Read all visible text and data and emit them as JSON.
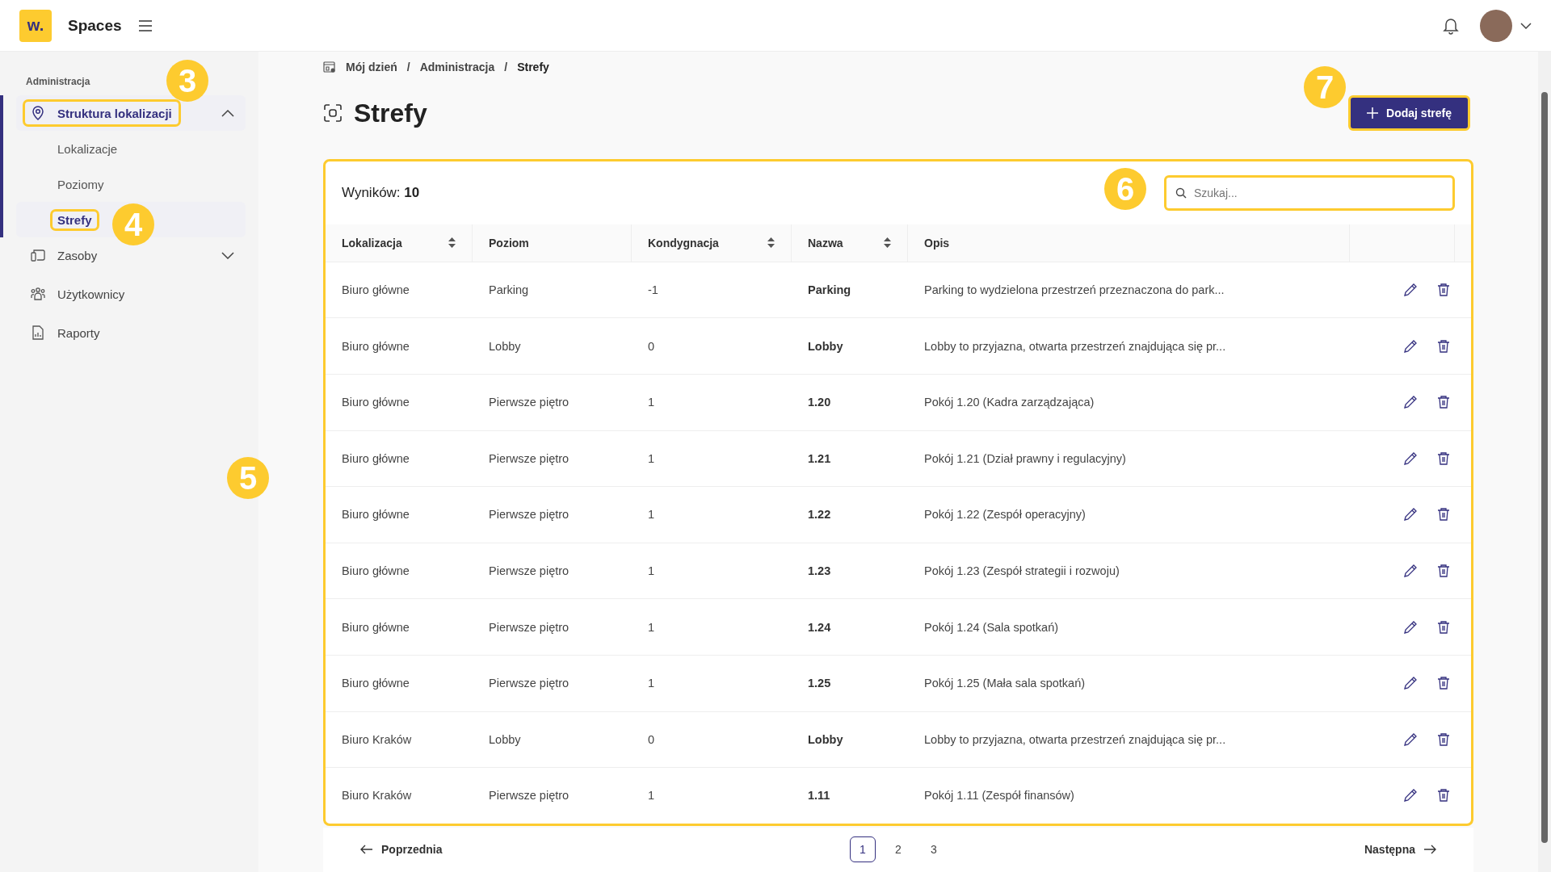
{
  "app": {
    "logo": "w.",
    "title": "Spaces"
  },
  "sidebar": {
    "section": "Administracja",
    "items": [
      {
        "label": "Struktura lokalizacji",
        "kind": "location",
        "expanded": true,
        "selected": true,
        "highlighted": true,
        "children": [
          {
            "label": "Lokalizacje",
            "selected": false,
            "highlighted": false
          },
          {
            "label": "Poziomy",
            "selected": false,
            "highlighted": false
          },
          {
            "label": "Strefy",
            "selected": true,
            "highlighted": true
          }
        ]
      },
      {
        "label": "Zasoby",
        "kind": "devices",
        "expanded": false,
        "selected": false,
        "highlighted": false
      },
      {
        "label": "Użytkownicy",
        "kind": "users",
        "selected": false,
        "highlighted": false
      },
      {
        "label": "Raporty",
        "kind": "reports",
        "selected": false,
        "highlighted": false
      }
    ]
  },
  "breadcrumb": [
    {
      "kind": "link",
      "text": "Mój dzień"
    },
    {
      "kind": "separator",
      "text": "/"
    },
    {
      "kind": "link",
      "text": "Administracja"
    },
    {
      "kind": "separator",
      "text": "/"
    },
    {
      "kind": "current",
      "text": "Strefy"
    }
  ],
  "page_title": "Strefy",
  "add_button": {
    "label": "Dodaj strefę",
    "highlighted": true
  },
  "results": {
    "label": "Wyników:",
    "count": "10"
  },
  "search": {
    "placeholder": "Szukaj...",
    "highlighted": true
  },
  "table": {
    "highlighted": true,
    "columns": [
      {
        "label": "Lokalizacja",
        "sortable": true
      },
      {
        "label": "Poziom",
        "sortable": false
      },
      {
        "label": "Kondygnacja",
        "sortable": true
      },
      {
        "label": "Nazwa",
        "sortable": true
      },
      {
        "label": "Opis",
        "sortable": false
      }
    ],
    "rows": [
      [
        "Biuro główne",
        "Parking",
        "-1",
        "Parking",
        "Parking to wydzielona przestrzeń przeznaczona do park..."
      ],
      [
        "Biuro główne",
        "Lobby",
        "0",
        "Lobby",
        "Lobby to przyjazna, otwarta przestrzeń znajdująca się pr..."
      ],
      [
        "Biuro główne",
        "Pierwsze piętro",
        "1",
        "1.20",
        "Pokój 1.20 (Kadra zarządzająca)"
      ],
      [
        "Biuro główne",
        "Pierwsze piętro",
        "1",
        "1.21",
        "Pokój 1.21 (Dział prawny i regulacyjny)"
      ],
      [
        "Biuro główne",
        "Pierwsze piętro",
        "1",
        "1.22",
        "Pokój 1.22 (Zespół operacyjny)"
      ],
      [
        "Biuro główne",
        "Pierwsze piętro",
        "1",
        "1.23",
        "Pokój 1.23 (Zespół strategii i rozwoju)"
      ],
      [
        "Biuro główne",
        "Pierwsze piętro",
        "1",
        "1.24",
        "Pokój 1.24 (Sala spotkań)"
      ],
      [
        "Biuro główne",
        "Pierwsze piętro",
        "1",
        "1.25",
        "Pokój 1.25 (Mała sala spotkań)"
      ],
      [
        "Biuro Kraków",
        "Lobby",
        "0",
        "Lobby",
        "Lobby to przyjazna, otwarta przestrzeń znajdująca się pr..."
      ],
      [
        "Biuro Kraków",
        "Pierwsze piętro",
        "1",
        "1.11",
        "Pokój 1.11 (Zespół finansów)"
      ]
    ]
  },
  "pagination": {
    "previous": "Poprzednia",
    "next": "Następna",
    "pages": [
      {
        "label": "1",
        "selected": true
      },
      {
        "label": "2",
        "selected": false
      },
      {
        "label": "3",
        "selected": false
      }
    ]
  },
  "callouts": [
    "3",
    "4",
    "5",
    "6",
    "7"
  ]
}
